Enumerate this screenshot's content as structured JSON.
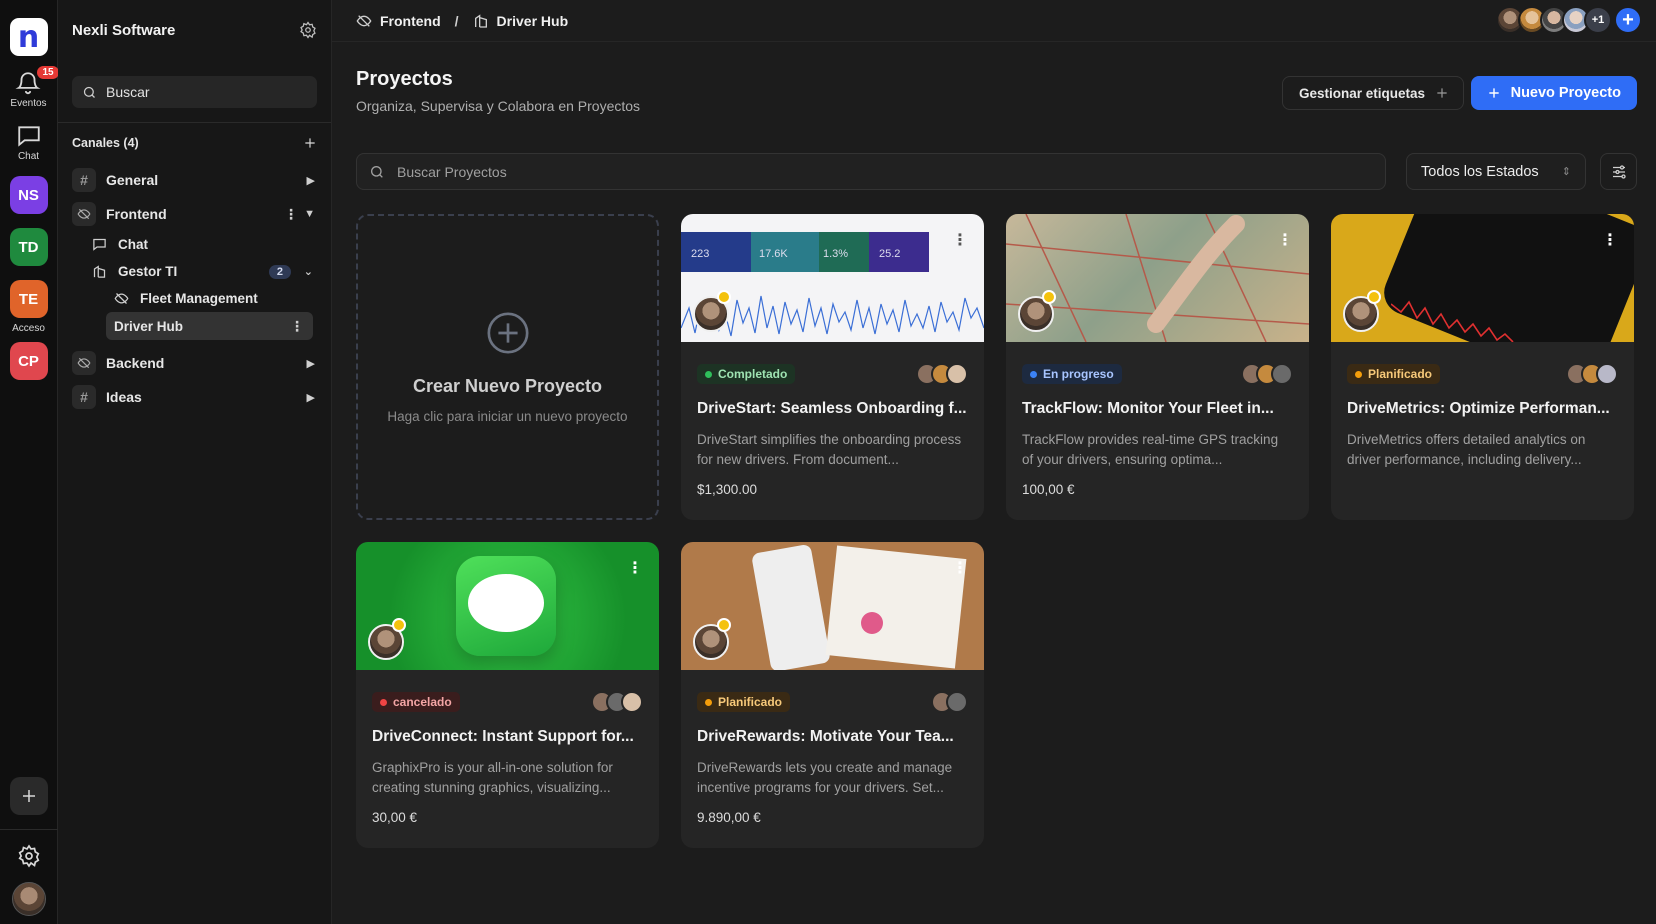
{
  "rail": {
    "logo": "n",
    "events_label": "Eventos",
    "events_badge": "15",
    "chat_label": "Chat",
    "workspaces": [
      {
        "initials": "NS",
        "color": "#7b3fe4"
      },
      {
        "initials": "TD",
        "color": "#1f8a3e"
      },
      {
        "initials": "TE",
        "color": "#e0642a"
      },
      {
        "initials": "CP",
        "color": "#e0474e"
      }
    ],
    "acceso_label": "Acceso"
  },
  "sidebar": {
    "org_name": "Nexli Software",
    "search_placeholder": "Buscar",
    "channels_label": "Canales (4)",
    "channels": {
      "general": "General",
      "frontend": "Frontend",
      "frontend_chat": "Chat",
      "gestor": "Gestor TI",
      "gestor_count": "2",
      "fleet": "Fleet Management",
      "driver_hub": "Driver Hub",
      "backend": "Backend",
      "ideas": "Ideas"
    }
  },
  "topbar": {
    "crumb_1": "Frontend",
    "crumb_sep": "/",
    "crumb_2": "Driver Hub",
    "more_members": "+1"
  },
  "main": {
    "title": "Proyectos",
    "subtitle": "Organiza, Supervisa y Colabora en Proyectos",
    "manage_tags": "Gestionar etiquetas",
    "new_project": "Nuevo Proyecto",
    "search_placeholder": "Buscar Proyectos",
    "status_filter": "Todos los Estados",
    "create_title": "Crear Nuevo Proyecto",
    "create_desc": "Haga clic para iniciar un nuevo proyecto"
  },
  "projects": [
    {
      "status": "Completado",
      "status_color": "#2fbf5b",
      "status_bg": "#1d3324",
      "status_text": "#9fe3b2",
      "title": "DriveStart: Seamless Onboarding f...",
      "desc": "DriveStart simplifies the onboarding process for new drivers. From document...",
      "price": "$1,300.00"
    },
    {
      "status": "En progreso",
      "status_color": "#3b82f6",
      "status_bg": "#1d2a40",
      "status_text": "#a8c5ff",
      "title": "TrackFlow: Monitor Your Fleet in...",
      "desc": "TrackFlow provides real-time GPS tracking of your drivers, ensuring optima...",
      "price": "100,00 €"
    },
    {
      "status": "Planificado",
      "status_color": "#f59e0b",
      "status_bg": "#3a2a14",
      "status_text": "#f7c97a",
      "title": "DriveMetrics: Optimize Performan...",
      "desc": "DriveMetrics offers detailed analytics on driver performance, including delivery...",
      "price": ""
    },
    {
      "status": "cancelado",
      "status_color": "#ef4444",
      "status_bg": "#3a1d1d",
      "status_text": "#f3a5a5",
      "title": "DriveConnect: Instant Support for...",
      "desc": "GraphixPro is your all-in-one solution for creating stunning graphics, visualizing...",
      "price": "30,00 €"
    },
    {
      "status": "Planificado",
      "status_color": "#f59e0b",
      "status_bg": "#3a2a14",
      "status_text": "#f7c97a",
      "title": "DriveRewards: Motivate Your Tea...",
      "desc": "DriveRewards lets you create and manage incentive programs for your drivers. Set...",
      "price": "9.890,00 €"
    }
  ],
  "dashboard_thumb": {
    "metrics": [
      "223",
      "17.6K",
      "1.3%",
      "25.2"
    ]
  },
  "colors": {
    "accent": "#2f6df6",
    "background": "#1c1c1c",
    "card": "#252525"
  }
}
